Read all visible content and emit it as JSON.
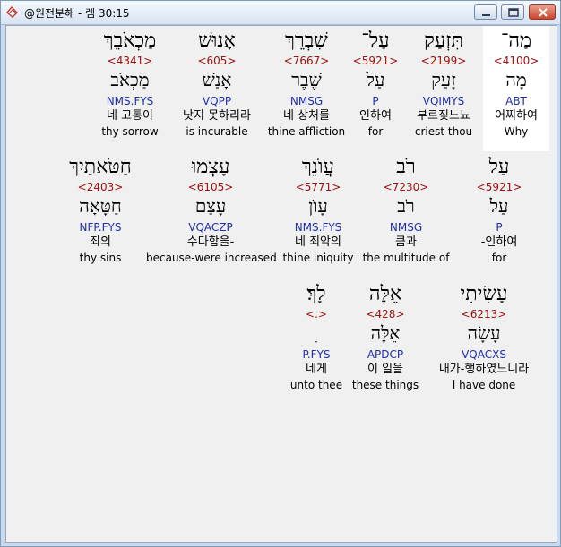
{
  "window": {
    "title": "@원전분해 - 렘 30:15"
  },
  "rows": [
    {
      "words": [
        {
          "hebrew": "מַה־",
          "strong": "<4100>",
          "lemma": "מָה",
          "morph": "ABT",
          "korean": "어찌하여",
          "english": "Why",
          "highlight": true
        },
        {
          "hebrew": "תִּזְעַק",
          "strong": "<2199>",
          "lemma": "זָעַק",
          "morph": "VQIMYS",
          "korean": "부르짖느뇨",
          "english": "criest thou"
        },
        {
          "hebrew": "עַל־",
          "strong": "<5921>",
          "lemma": "עַל",
          "morph": "P",
          "korean": "인하여",
          "english": "for"
        },
        {
          "hebrew": "שִׁבְרֵךְ",
          "strong": "<7667>",
          "lemma": "שֶׁבֶר",
          "morph": "NMSG",
          "korean": "네 상처를",
          "english": "thine affliction"
        },
        {
          "hebrew": "אָנוּשׁ",
          "strong": "<605>",
          "lemma": "אָנַשׁ",
          "morph": "VQPP",
          "korean": "낫지 못하리라",
          "english": "is incurable"
        },
        {
          "hebrew": "מַכְאֹבֵךְ",
          "strong": "<4341>",
          "lemma": "מַכְאֹב",
          "morph": "NMS.FYS",
          "korean": "네 고통이",
          "english": "thy sorrow"
        }
      ]
    },
    {
      "words": [
        {
          "hebrew": "עַל",
          "strong": "<5921>",
          "lemma": "עַל",
          "morph": "P",
          "korean": "-인하여",
          "english": "for"
        },
        {
          "hebrew": "רֹב",
          "strong": "<7230>",
          "lemma": "רֹב",
          "morph": "NMSG",
          "korean": "큼과",
          "english": "the multitude of"
        },
        {
          "hebrew": "עֲוֺנֵךְ",
          "strong": "<5771>",
          "lemma": "עָוֺן",
          "morph": "NMS.FYS",
          "korean": "네 죄악의",
          "english": "thine iniquity"
        },
        {
          "hebrew": "עָצְמוּ",
          "strong": "<6105>",
          "lemma": "עָצַם",
          "morph": "VQACZP",
          "korean": "수다함을-",
          "english": "because-were increased"
        },
        {
          "hebrew": "חַטֹּאתַיִךְ",
          "strong": "<2403>",
          "lemma": "חַטָּאָה",
          "morph": "NFP.FYS",
          "korean": "죄의",
          "english": "thy sins"
        }
      ]
    },
    {
      "words": [
        {
          "hebrew": "עָשִׂיתִי",
          "strong": "<6213>",
          "lemma": "עָשָׂה",
          "morph": "VQACXS",
          "korean": "내가-행하였느니라",
          "english": "I have done"
        },
        {
          "hebrew": "אֵלֶּה",
          "strong": "<428>",
          "lemma": "אֵלֶּה",
          "morph": "APDCP",
          "korean": "이 일을",
          "english": "these things"
        },
        {
          "hebrew": "לָךְ׃",
          "strong": "<.>",
          "lemma": "ִ",
          "morph": "P.FYS",
          "korean": "네게",
          "english": "unto thee"
        }
      ]
    }
  ]
}
